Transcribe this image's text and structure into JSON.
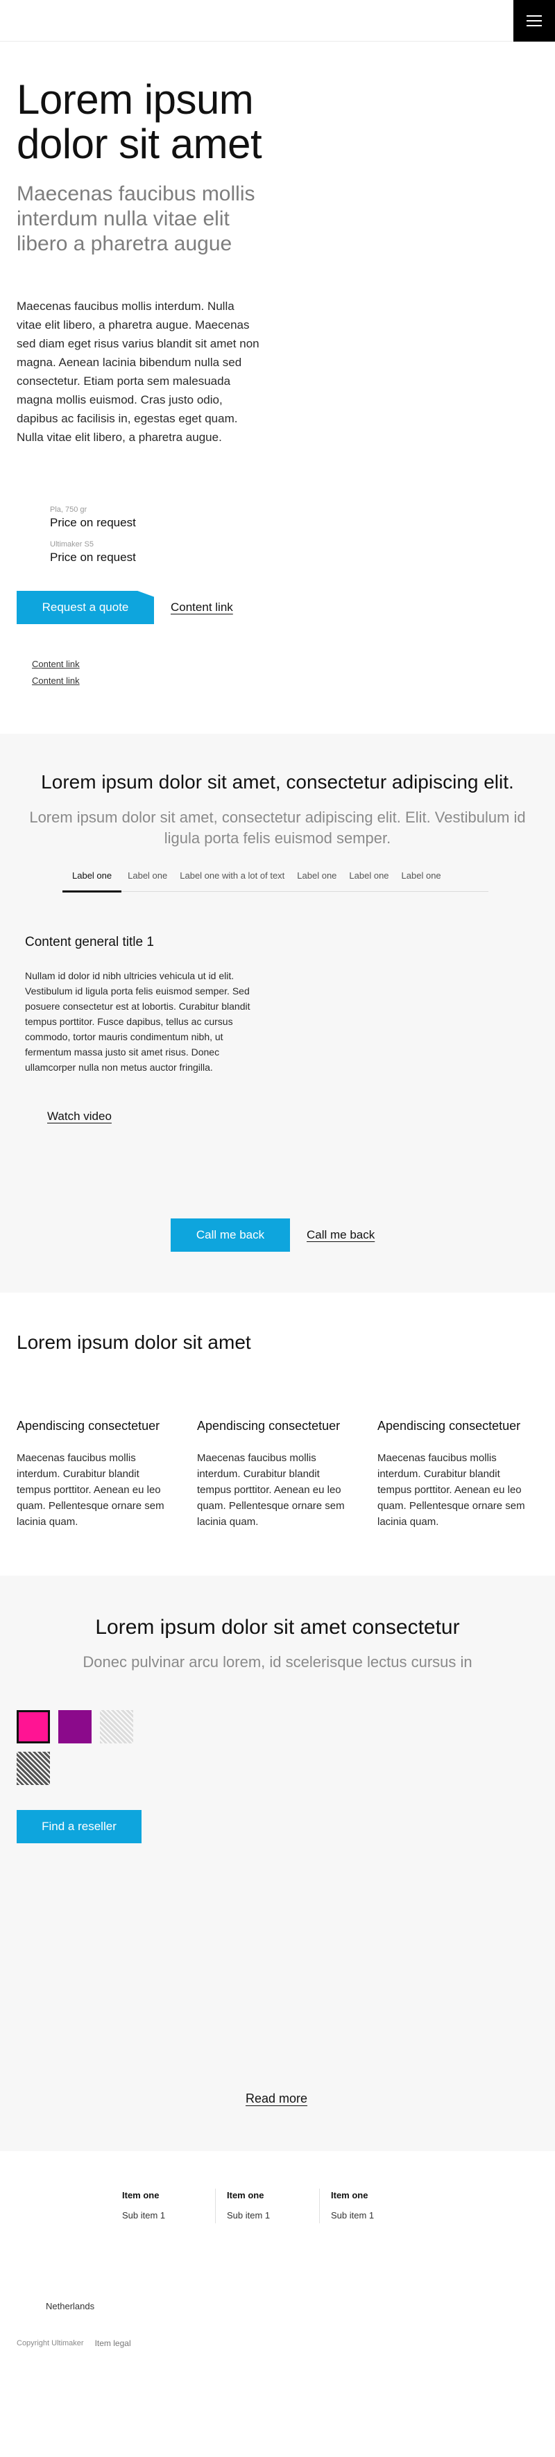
{
  "header": {
    "menu_icon": "hamburger-icon"
  },
  "hero": {
    "title": "Lorem ipsum dolor sit amet",
    "subtitle": "Maecenas faucibus mollis interdum nulla vitae elit libero a pharetra augue",
    "body": "Maecenas faucibus mollis interdum. Nulla vitae elit libero, a pharetra augue. Maecenas sed diam eget risus varius blandit sit amet non magna. Aenean lacinia bibendum nulla sed consectetur. Etiam porta sem malesuada magna mollis euismod. Cras justo odio, dapibus ac facilisis in, egestas eget quam. Nulla vitae elit libero, a pharetra augue."
  },
  "prices": [
    {
      "label": "Pla, 750 gr",
      "value": "Price on request"
    },
    {
      "label": "Ultimaker S5",
      "value": "Price on request"
    }
  ],
  "cta1": {
    "primary": "Request a quote",
    "link": "Content link"
  },
  "small_links": [
    "Content link",
    "Content link"
  ],
  "section2": {
    "title": "Lorem ipsum dolor sit amet, consectetur adipiscing elit.",
    "subtitle": "Lorem ipsum dolor sit amet, consectetur adipiscing elit. Elit. Vestibulum id ligula porta felis euismod semper.",
    "tabs": [
      "Label one",
      "Label one",
      "Label one with a lot of text",
      "Label one",
      "Label one",
      "Label one"
    ],
    "content_title": "Content general title 1",
    "content_body": "Nullam id dolor id nibh ultricies vehicula ut id elit. Vestibulum id ligula porta felis euismod semper. Sed posuere consectetur est at lobortis. Curabitur blandit tempus porttitor. Fusce dapibus, tellus ac cursus commodo, tortor mauris condimentum nibh, ut fermentum massa justo sit amet risus. Donec ullamcorper nulla non metus auctor fringilla.",
    "watch_video": "Watch video",
    "cta_primary": "Call me back",
    "cta_link": "Call me back"
  },
  "section3": {
    "title": "Lorem ipsum dolor sit amet",
    "columns": [
      {
        "title": "Apendiscing consectetuer",
        "body": "Maecenas faucibus mollis interdum. Curabitur blandit tempus porttitor. Aenean eu leo quam. Pellentesque ornare sem lacinia quam."
      },
      {
        "title": "Apendiscing consectetuer",
        "body": "Maecenas faucibus mollis interdum. Curabitur blandit tempus porttitor. Aenean eu leo quam. Pellentesque ornare sem lacinia quam."
      },
      {
        "title": "Apendiscing consectetuer",
        "body": "Maecenas faucibus mollis interdum. Curabitur blandit tempus porttitor. Aenean eu leo quam. Pellentesque ornare sem lacinia quam."
      }
    ]
  },
  "section4": {
    "title": "Lorem ipsum dolor sit amet consectetur",
    "subtitle": "Donec pulvinar arcu lorem, id scelerisque lectus cursus in",
    "swatches": [
      {
        "color": "#ff1493",
        "selected": true
      },
      {
        "color": "#8b0a8b",
        "selected": false
      },
      {
        "color": "#dcdcdc",
        "selected": false,
        "pattern": "stripes"
      },
      {
        "color": "#555555",
        "selected": false,
        "pattern": "stripes"
      }
    ],
    "reseller_button": "Find a reseller",
    "read_more": "Read more"
  },
  "footer": {
    "nav": [
      {
        "head": "Item one",
        "item": "Sub item 1"
      },
      {
        "head": "Item one",
        "item": "Sub item 1"
      },
      {
        "head": "Item one",
        "item": "Sub item 1"
      }
    ],
    "country": "Netherlands",
    "copyright": "Copyright Ultimaker",
    "legal": "Item legal"
  },
  "colors": {
    "accent": "#0ea5dd",
    "section_bg": "#f7f7f7",
    "menu_bg": "#000000"
  }
}
